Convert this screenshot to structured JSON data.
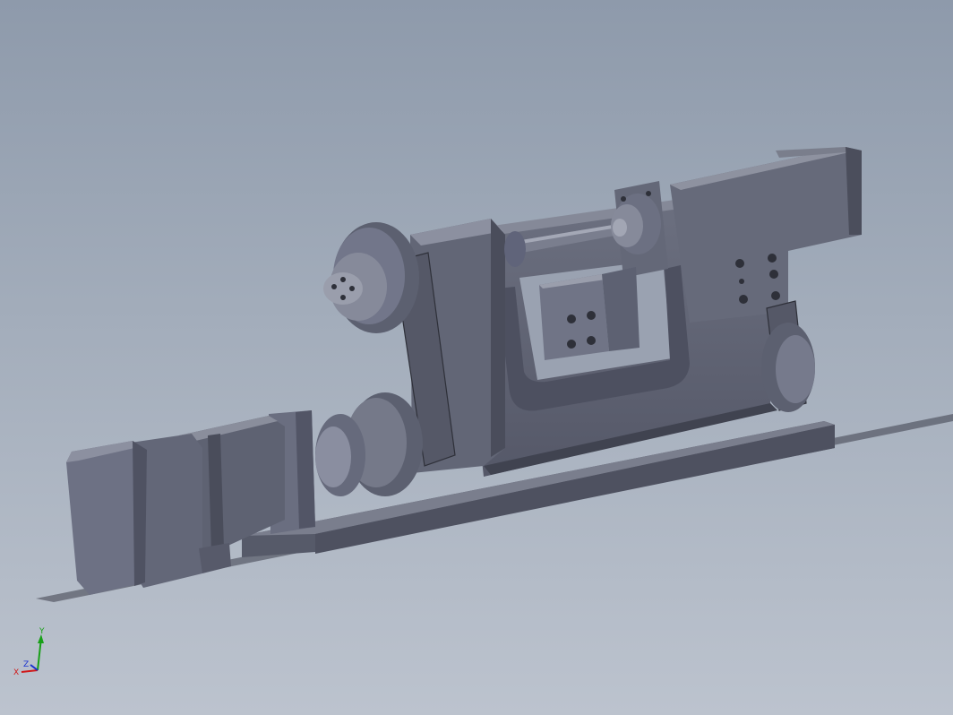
{
  "viewport": {
    "background_top": "#8e9aab",
    "background_bottom": "#bcc3ce",
    "part_color": "#5e6272",
    "part_shadow_color": "#474a57",
    "part_highlight_color": "#8b8f9e"
  },
  "triad": {
    "x_label": "X",
    "y_label": "Y",
    "z_label": "Z",
    "x_color": "#d01818",
    "y_color": "#18a018",
    "z_color": "#1830d0"
  }
}
